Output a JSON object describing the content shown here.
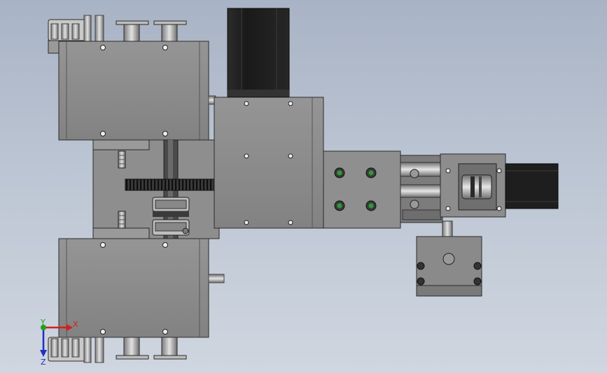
{
  "triad": {
    "x_label": "X",
    "y_label": "Y",
    "z_label": "Z",
    "x_color": "#d22020",
    "y_color": "#20a020",
    "z_color": "#2030c0"
  },
  "palette": {
    "background_top": "#a8b3c5",
    "background_bottom": "#cfd6e0",
    "body_gray": "#8c8c8c",
    "motor_black": "#1e1e1e",
    "edge": "#2a2a2a",
    "screw_green": "#2e9a3a"
  }
}
